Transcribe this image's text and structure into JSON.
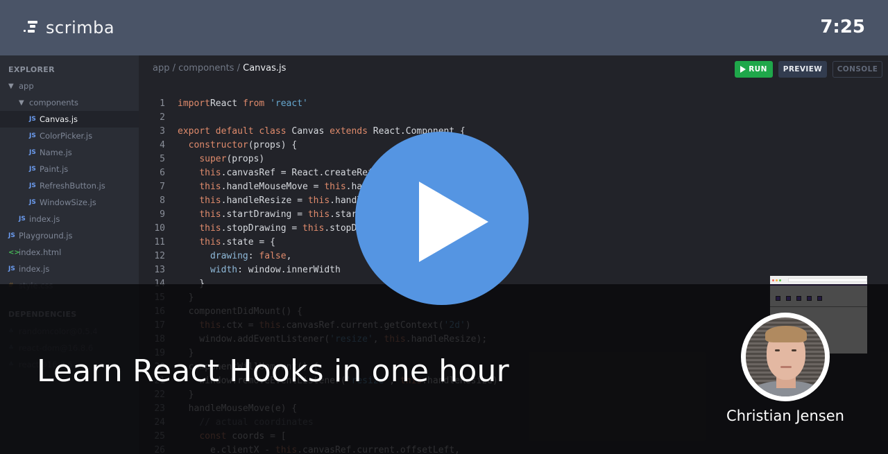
{
  "brand": {
    "name": "scrimba",
    "logo_icon": "scrimba-logo-icon"
  },
  "timer": "7:25",
  "sidebar": {
    "explorer_label": "EXPLORER",
    "tree": [
      {
        "label": "app",
        "type": "folder",
        "icon": "caret-down",
        "depth": 0
      },
      {
        "label": "components",
        "type": "folder",
        "icon": "caret-down",
        "depth": 1
      },
      {
        "label": "Canvas.js",
        "type": "js",
        "icon": "JS",
        "depth": 2,
        "active": true
      },
      {
        "label": "ColorPicker.js",
        "type": "js",
        "icon": "JS",
        "depth": 2
      },
      {
        "label": "Name.js",
        "type": "js",
        "icon": "JS",
        "depth": 2
      },
      {
        "label": "Paint.js",
        "type": "js",
        "icon": "JS",
        "depth": 2
      },
      {
        "label": "RefreshButton.js",
        "type": "js",
        "icon": "JS",
        "depth": 2
      },
      {
        "label": "WindowSize.js",
        "type": "js",
        "icon": "JS",
        "depth": 2
      },
      {
        "label": "index.js",
        "type": "js",
        "icon": "JS",
        "depth": 1
      },
      {
        "label": "Playground.js",
        "type": "js",
        "icon": "JS",
        "depth": 0
      },
      {
        "label": "index.html",
        "type": "html",
        "icon": "<>",
        "depth": 0
      },
      {
        "label": "index.js",
        "type": "js",
        "icon": "JS",
        "depth": 0
      },
      {
        "label": "style.css",
        "type": "css",
        "icon": "#",
        "depth": 0
      }
    ],
    "dependencies_label": "DEPENDENCIES",
    "dependencies": [
      {
        "label": "randomcolor@0.5.4",
        "icon": "package"
      },
      {
        "label": "react-dom@16.8.6",
        "icon": "package"
      },
      {
        "label": "react@16.8.6",
        "icon": "package"
      }
    ]
  },
  "editor": {
    "breadcrumb": {
      "parts": [
        "app",
        "components"
      ],
      "current": "Canvas.js",
      "separator": " / "
    },
    "buttons": {
      "run": "RUN",
      "preview": "PREVIEW",
      "console": "CONSOLE"
    },
    "lines": [
      {
        "n": "1",
        "tokens": [
          [
            "kw",
            "import"
          ],
          [
            "",
            "React "
          ],
          [
            "kw",
            "from"
          ],
          [
            "",
            " "
          ],
          [
            "str",
            "'react'"
          ]
        ]
      },
      {
        "n": "2",
        "tokens": []
      },
      {
        "n": "3",
        "tokens": [
          [
            "kw",
            "export default class"
          ],
          [
            "",
            " Canvas "
          ],
          [
            "kw",
            "extends"
          ],
          [
            "",
            " React.Component {"
          ]
        ]
      },
      {
        "n": "4",
        "tokens": [
          [
            "",
            "  "
          ],
          [
            "kw",
            "constructor"
          ],
          [
            "",
            "(props) {"
          ]
        ]
      },
      {
        "n": "5",
        "tokens": [
          [
            "",
            "    "
          ],
          [
            "kw",
            "super"
          ],
          [
            "",
            "(props)"
          ]
        ]
      },
      {
        "n": "6",
        "tokens": [
          [
            "",
            "    "
          ],
          [
            "kw",
            "this"
          ],
          [
            "",
            ".canvasRef = React.createRef()"
          ]
        ]
      },
      {
        "n": "7",
        "tokens": [
          [
            "",
            "    "
          ],
          [
            "kw",
            "this"
          ],
          [
            "",
            ".handleMouseMove = "
          ],
          [
            "kw",
            "this"
          ],
          [
            "",
            ".handleMouseMove.bind(this)"
          ]
        ]
      },
      {
        "n": "8",
        "tokens": [
          [
            "",
            "    "
          ],
          [
            "kw",
            "this"
          ],
          [
            "",
            ".handleResize = "
          ],
          [
            "kw",
            "this"
          ],
          [
            "",
            ".handleResize.bind(this)"
          ]
        ]
      },
      {
        "n": "9",
        "tokens": [
          [
            "",
            "    "
          ],
          [
            "kw",
            "this"
          ],
          [
            "",
            ".startDrawing = "
          ],
          [
            "kw",
            "this"
          ],
          [
            "",
            ".startDrawing.bind(this)"
          ]
        ]
      },
      {
        "n": "10",
        "tokens": [
          [
            "",
            "    "
          ],
          [
            "kw",
            "this"
          ],
          [
            "",
            ".stopDrawing = "
          ],
          [
            "kw",
            "this"
          ],
          [
            "",
            ".stopDrawing.bind(this)"
          ]
        ]
      },
      {
        "n": "11",
        "tokens": [
          [
            "",
            "    "
          ],
          [
            "kw",
            "this"
          ],
          [
            "",
            ".state = {"
          ]
        ]
      },
      {
        "n": "12",
        "tokens": [
          [
            "",
            "      "
          ],
          [
            "prop",
            "drawing"
          ],
          [
            "",
            ": "
          ],
          [
            "kw",
            "false"
          ],
          [
            "",
            ","
          ]
        ]
      },
      {
        "n": "13",
        "tokens": [
          [
            "",
            "      "
          ],
          [
            "prop",
            "width"
          ],
          [
            "",
            ": window.innerWidth"
          ]
        ]
      },
      {
        "n": "14",
        "tokens": [
          [
            "",
            "    }"
          ]
        ]
      },
      {
        "n": "15",
        "tokens": [
          [
            "",
            "  }"
          ]
        ]
      },
      {
        "n": "16",
        "tokens": [
          [
            "",
            "  componentDidMount() {"
          ]
        ]
      },
      {
        "n": "17",
        "tokens": [
          [
            "",
            "    "
          ],
          [
            "kw",
            "this"
          ],
          [
            "",
            ".ctx = "
          ],
          [
            "kw",
            "this"
          ],
          [
            "",
            ".canvasRef.current.getContext("
          ],
          [
            "str",
            "'2d'"
          ],
          [
            "",
            ")"
          ]
        ]
      },
      {
        "n": "18",
        "tokens": [
          [
            "",
            "    window.addEventListener("
          ],
          [
            "str",
            "'resize'"
          ],
          [
            "",
            ", "
          ],
          [
            "kw",
            "this"
          ],
          [
            "",
            ".handleResize);"
          ]
        ]
      },
      {
        "n": "19",
        "tokens": [
          [
            "",
            "  }"
          ]
        ]
      },
      {
        "n": "20",
        "tokens": [
          [
            "",
            "  componentWillUnmount() {"
          ]
        ]
      },
      {
        "n": "21",
        "tokens": [
          [
            "",
            "    window.removeEventListener("
          ],
          [
            "str",
            "'resize'"
          ],
          [
            "",
            ", "
          ],
          [
            "kw",
            "this"
          ],
          [
            "",
            ".handleResize)"
          ]
        ]
      },
      {
        "n": "22",
        "tokens": [
          [
            "",
            "  }"
          ]
        ]
      },
      {
        "n": "23",
        "tokens": [
          [
            "",
            "  handleMouseMove(e) {"
          ]
        ]
      },
      {
        "n": "24",
        "tokens": [
          [
            "",
            "    "
          ],
          [
            "cm",
            "// actual coordinates"
          ]
        ]
      },
      {
        "n": "25",
        "tokens": [
          [
            "",
            "    "
          ],
          [
            "kw",
            "const"
          ],
          [
            "",
            " coords = ["
          ]
        ]
      },
      {
        "n": "26",
        "tokens": [
          [
            "",
            "      e.clientX - "
          ],
          [
            "kw",
            "this"
          ],
          [
            "",
            ".canvasRef.current.offsetLeft,"
          ]
        ]
      }
    ]
  },
  "video": {
    "title": "Learn React Hooks in one hour",
    "instructor": "Christian Jensen",
    "play_icon": "play-icon",
    "accent_color": "#5595e2"
  },
  "colors": {
    "run": "#1fa74a",
    "topbar": "#4a5467"
  }
}
